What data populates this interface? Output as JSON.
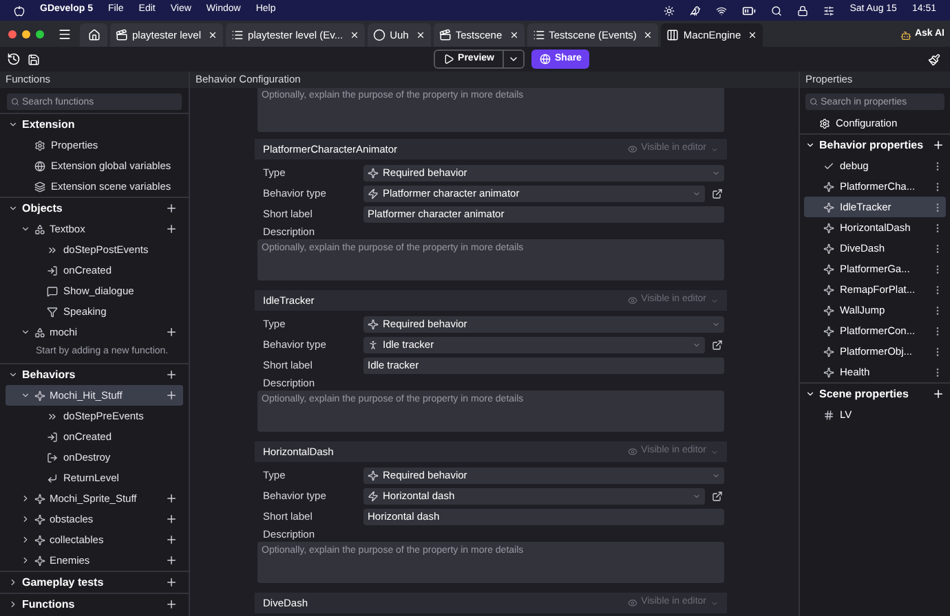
{
  "menubar": {
    "app": "GDevelop 5",
    "menus": [
      "File",
      "Edit",
      "View",
      "Window",
      "Help"
    ],
    "date": "Sat Aug 15",
    "time": "14:51"
  },
  "tabs": [
    {
      "label": "playtester level",
      "kind": "scene",
      "selected": false
    },
    {
      "label": "playtester level (Ev...",
      "kind": "events",
      "selected": false
    },
    {
      "label": "Uuh",
      "kind": "external",
      "selected": false
    },
    {
      "label": "Testscene",
      "kind": "scene",
      "selected": false
    },
    {
      "label": "Testscene (Events)",
      "kind": "events",
      "selected": false
    },
    {
      "label": "MacnEngine",
      "kind": "extension",
      "selected": true
    }
  ],
  "ask_ai": "Ask AI",
  "toolbar": {
    "preview": "Preview",
    "share": "Share"
  },
  "functions_panel": {
    "title": "Functions",
    "search_placeholder": "Search functions",
    "groups": [
      {
        "label": "Extension",
        "kind": "group",
        "expanded": true,
        "children": [
          {
            "label": "Properties",
            "kind": "properties"
          },
          {
            "label": "Extension global variables",
            "kind": "global_variables"
          },
          {
            "label": "Extension scene variables",
            "kind": "scene_variables"
          }
        ]
      },
      {
        "label": "Objects",
        "kind": "group",
        "expanded": true,
        "children": [
          {
            "label": "Textbox",
            "kind": "object",
            "expanded": true,
            "selected": false,
            "children": [
              {
                "label": "doStepPostEvents",
                "kind": "step"
              },
              {
                "label": "onCreated",
                "kind": "created"
              },
              {
                "label": "Show_dialogue",
                "kind": "action"
              },
              {
                "label": "Speaking",
                "kind": "condition"
              }
            ]
          },
          {
            "label": "mochi",
            "kind": "object",
            "expanded": true,
            "selected": false,
            "children": [
              {
                "label": "Start by adding a new function.",
                "kind": "hint"
              }
            ]
          }
        ]
      },
      {
        "label": "Behaviors",
        "kind": "group",
        "expanded": true,
        "children": [
          {
            "label": "Mochi_Hit_Stuff",
            "kind": "behavior",
            "expanded": true,
            "selected": true,
            "children": [
              {
                "label": "doStepPreEvents",
                "kind": "step"
              },
              {
                "label": "onCreated",
                "kind": "created"
              },
              {
                "label": "onDestroy",
                "kind": "destroy"
              },
              {
                "label": "ReturnLevel",
                "kind": "return"
              }
            ]
          },
          {
            "label": "Mochi_Sprite_Stuff",
            "kind": "behavior",
            "expanded": false,
            "selected": false
          },
          {
            "label": "obstacles",
            "kind": "behavior",
            "expanded": false,
            "selected": false
          },
          {
            "label": "collectables",
            "kind": "behavior",
            "expanded": false,
            "selected": false
          },
          {
            "label": "Enemies",
            "kind": "behavior",
            "expanded": false,
            "selected": false
          }
        ]
      },
      {
        "label": "Gameplay tests",
        "kind": "group",
        "expanded": false
      },
      {
        "label": "Functions",
        "kind": "group",
        "expanded": false
      }
    ]
  },
  "behavior_configuration": {
    "title": "Behavior Configuration",
    "top_description_placeholder": "Optionally, explain the purpose of the property in more details",
    "properties": [
      {
        "name": "PlatformerCharacterAnimator",
        "visibility": "Visible in editor",
        "fields": [
          {
            "kind": "select",
            "label": "Type",
            "value": "Required behavior"
          },
          {
            "kind": "select_link",
            "label": "Behavior type",
            "value": "Platformer character animator"
          },
          {
            "kind": "text",
            "label": "Short label",
            "value": "Platformer character animator"
          },
          {
            "kind": "textarea",
            "label": "Description",
            "placeholder": "Optionally, explain the purpose of the property in more details"
          }
        ]
      },
      {
        "name": "IdleTracker",
        "visibility": "Visible in editor",
        "fields": [
          {
            "kind": "select",
            "label": "Type",
            "value": "Required behavior"
          },
          {
            "kind": "select_link",
            "label": "Behavior type",
            "value": "Idle tracker"
          },
          {
            "kind": "text",
            "label": "Short label",
            "value": "Idle tracker"
          },
          {
            "kind": "textarea",
            "label": "Description",
            "placeholder": "Optionally, explain the purpose of the property in more details"
          }
        ]
      },
      {
        "name": "HorizontalDash",
        "visibility": "Visible in editor",
        "fields": [
          {
            "kind": "select",
            "label": "Type",
            "value": "Required behavior"
          },
          {
            "kind": "select_link",
            "label": "Behavior type",
            "value": "Horizontal dash"
          },
          {
            "kind": "text",
            "label": "Short label",
            "value": "Horizontal dash"
          },
          {
            "kind": "textarea",
            "label": "Description",
            "placeholder": "Optionally, explain the purpose of the property in more details"
          }
        ]
      },
      {
        "name": "DiveDash",
        "visibility": "Visible in editor"
      }
    ]
  },
  "properties_panel": {
    "title": "Properties",
    "search_placeholder": "Search in properties",
    "configuration": "Configuration",
    "groups": [
      {
        "label": "Behavior properties",
        "expanded": true,
        "items": [
          {
            "label": "debug",
            "kind": "boolean",
            "selected": false
          },
          {
            "label": "PlatformerCha...",
            "kind": "behavior",
            "selected": false
          },
          {
            "label": "IdleTracker",
            "kind": "behavior",
            "selected": true
          },
          {
            "label": "HorizontalDash",
            "kind": "behavior",
            "selected": false
          },
          {
            "label": "DiveDash",
            "kind": "behavior",
            "selected": false
          },
          {
            "label": "PlatformerGa...",
            "kind": "behavior",
            "selected": false
          },
          {
            "label": "RemapForPlat...",
            "kind": "behavior",
            "selected": false
          },
          {
            "label": "WallJump",
            "kind": "behavior",
            "selected": false
          },
          {
            "label": "PlatformerCon...",
            "kind": "behavior",
            "selected": false
          },
          {
            "label": "PlatformerObj...",
            "kind": "behavior",
            "selected": false
          },
          {
            "label": "Health",
            "kind": "behavior",
            "selected": false
          }
        ]
      },
      {
        "label": "Scene properties",
        "expanded": true,
        "items": [
          {
            "label": "LV",
            "kind": "number",
            "selected": false
          }
        ]
      }
    ]
  }
}
